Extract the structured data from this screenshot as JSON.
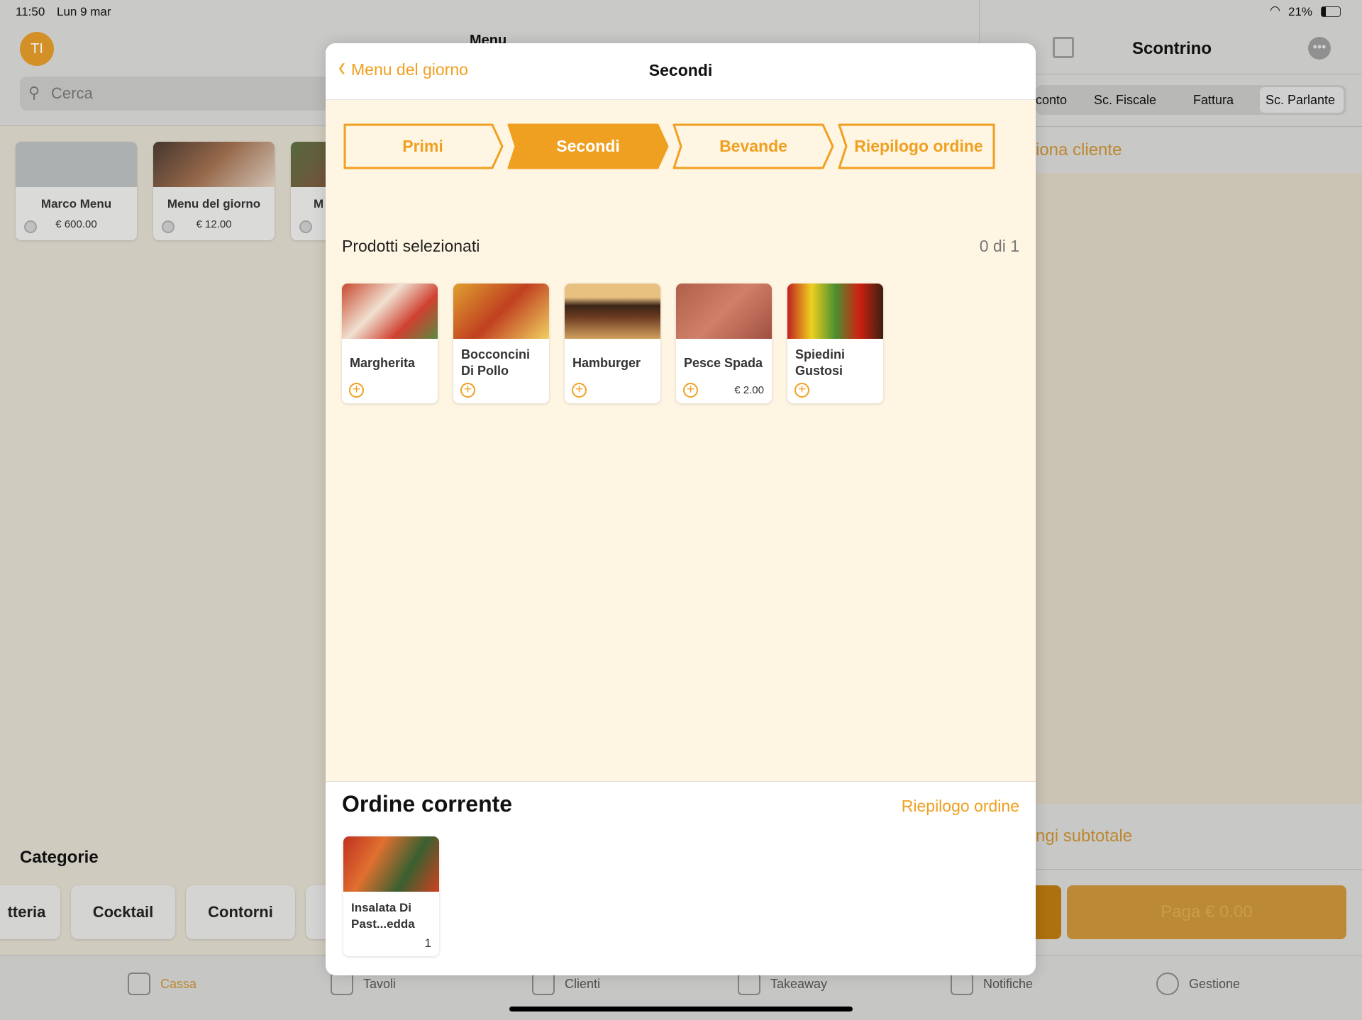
{
  "status": {
    "time": "11:50",
    "date": "Lun 9 mar",
    "battery": "21%"
  },
  "left": {
    "avatar": "TI",
    "title": "Menu",
    "search_placeholder": "Cerca",
    "menus": [
      {
        "name": "Marco Menu",
        "price": "€ 600.00"
      },
      {
        "name": "Menu del giorno",
        "price": "€ 12.00"
      },
      {
        "name": "M",
        "price": ""
      }
    ],
    "categories_title": "Categorie",
    "categories": [
      "tteria",
      "Cocktail",
      "Contorni"
    ]
  },
  "right": {
    "title": "Scontrino",
    "segments": [
      "conto",
      "Sc. Fiscale",
      "Fattura",
      "Sc. Parlante"
    ],
    "select_client": "iona cliente",
    "subtotal": "ngi subtotale",
    "pay": "Paga € 0.00"
  },
  "tabbar": [
    {
      "label": "Cassa",
      "icon": "basket-icon"
    },
    {
      "label": "Tavoli",
      "icon": "table-icon"
    },
    {
      "label": "Clienti",
      "icon": "person-icon"
    },
    {
      "label": "Takeaway",
      "icon": "cart-icon"
    },
    {
      "label": "Notifiche",
      "icon": "bell-icon"
    },
    {
      "label": "Gestione",
      "icon": "gear-icon"
    }
  ],
  "modal": {
    "back": "Menu del giorno",
    "title": "Secondi",
    "steps": [
      {
        "label": "Primi",
        "active": false
      },
      {
        "label": "Secondi",
        "active": true
      },
      {
        "label": "Bevande",
        "active": false
      },
      {
        "label": "Riepilogo ordine",
        "active": false
      }
    ],
    "selected_label": "Prodotti selezionati",
    "selected_count": "0 di 1",
    "products": [
      {
        "name": "Margherita",
        "price": ""
      },
      {
        "name": "Bocconcini Di Pollo",
        "price": ""
      },
      {
        "name": "Hamburger",
        "price": ""
      },
      {
        "name": "Pesce Spada",
        "price": "€ 2.00"
      },
      {
        "name": "Spiedini Gustosi",
        "price": ""
      }
    ],
    "order_title": "Ordine corrente",
    "order_summary_link": "Riepilogo ordine",
    "order_items": [
      {
        "name": "Insalata Di Past...edda",
        "qty": "1"
      }
    ]
  },
  "colors": {
    "accent": "#f0a020",
    "modal_bg": "#fff5e3"
  }
}
